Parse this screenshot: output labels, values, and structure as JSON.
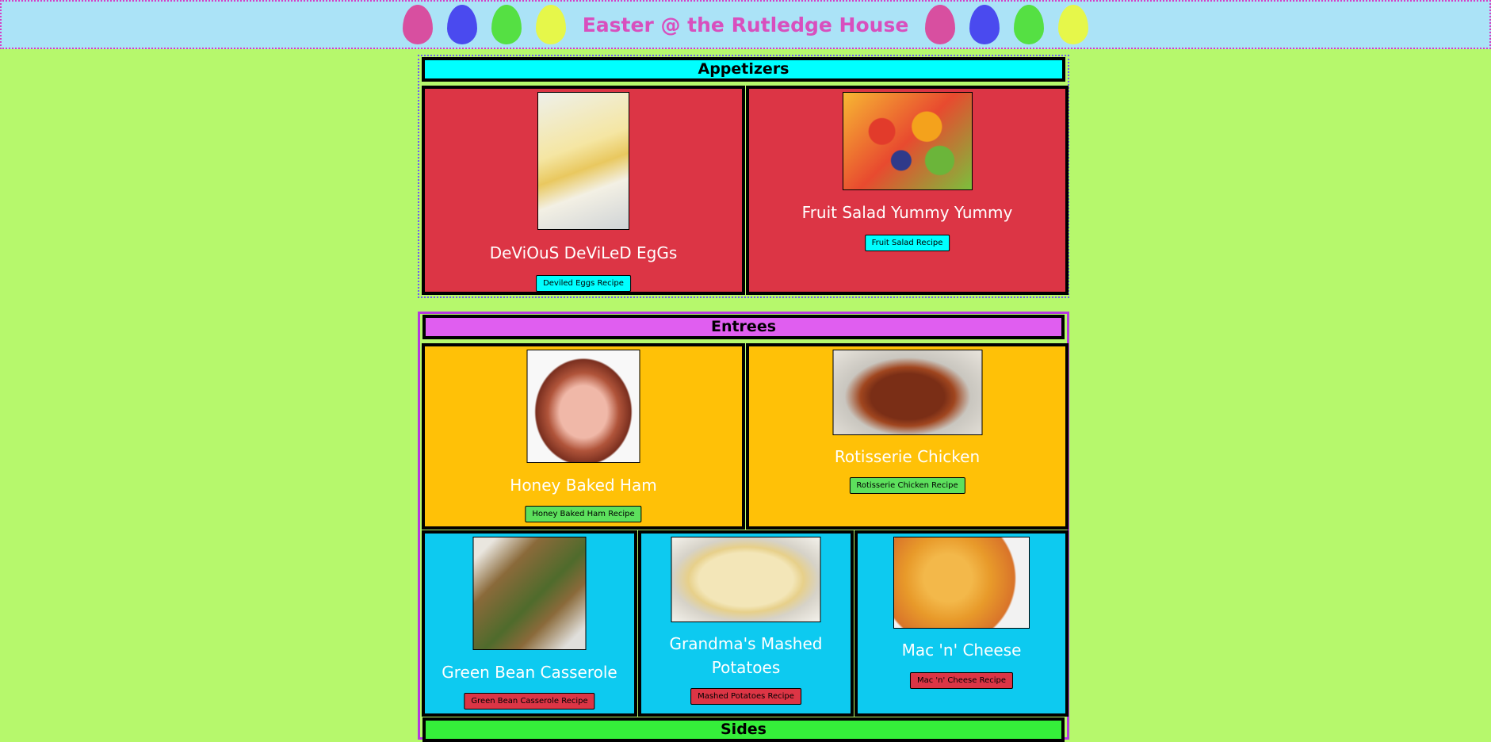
{
  "header": {
    "title": "Easter @ the Rutledge House",
    "egg_colors": [
      "#d84fa0",
      "#4a4aef",
      "#55e043",
      "#e6f74a"
    ]
  },
  "appetizers": {
    "title": "Appetizers",
    "title_bg": "#00ffff",
    "cards": [
      {
        "name": "DeViOuS DeViLeD EgGs",
        "button": "Deviled Eggs Recipe"
      },
      {
        "name": "Fruit Salad Yummy Yummy",
        "button": "Fruit Salad Recipe"
      }
    ]
  },
  "entrees": {
    "title": "Entrees",
    "title_bg": "#e05ef0",
    "cards": [
      {
        "name": "Honey Baked Ham",
        "button": "Honey Baked Ham Recipe"
      },
      {
        "name": "Rotisserie Chicken",
        "button": "Rotisserie Chicken Recipe"
      },
      {
        "name": "Green Bean Casserole",
        "button": "Green Bean Casserole Recipe"
      },
      {
        "name": "Grandma's Mashed Potatoes",
        "button": "Mashed Potatoes Recipe"
      },
      {
        "name": "Mac 'n' Cheese",
        "button": "Mac 'n' Cheese Recipe"
      }
    ]
  },
  "sides": {
    "title": "Sides",
    "title_bg": "#35ef3a"
  }
}
